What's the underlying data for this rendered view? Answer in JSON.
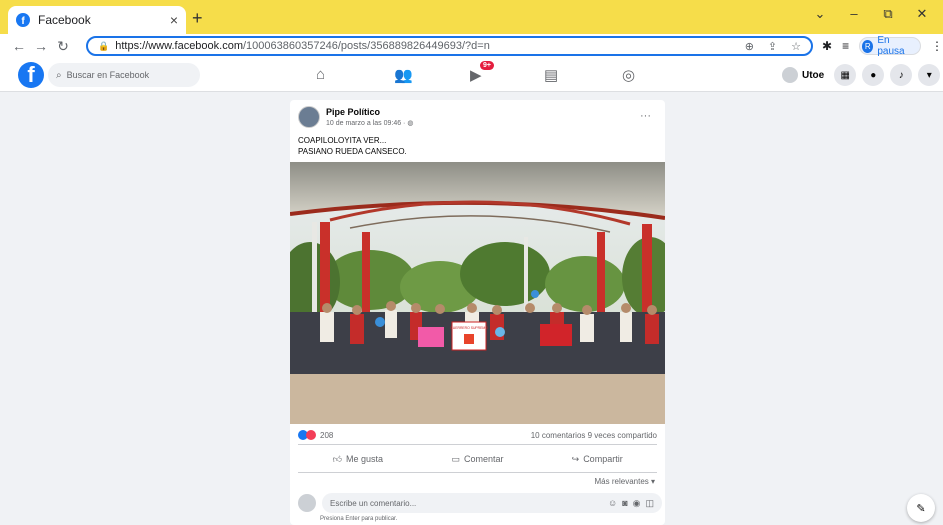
{
  "browser": {
    "tab_title": "Facebook",
    "tab_close": "×",
    "new_tab": "+",
    "url_host": "https://www.facebook.com",
    "url_path": "/100063860357246/posts/356889826449693/?d=n",
    "profile_initial": "R",
    "profile_status": "En pausa",
    "window_minimize": "–",
    "window_restore": "⧉",
    "window_close": "✕"
  },
  "facebook": {
    "logo_letter": "f",
    "search_placeholder": "Buscar en Facebook",
    "video_badge": "9+",
    "user_name": "Utoe"
  },
  "post": {
    "author": "Pipe Político",
    "date": "10 de marzo a las 09:46 · ",
    "line1": "COAPILOLOYITA VER...",
    "line2": "PASIANO RUEDA CANSECO.",
    "reactions_count": "208",
    "stats": "10 comentarios  9 veces compartido",
    "like_label": "Me gusta",
    "comment_label": "Comentar",
    "share_label": "Compartir",
    "sort_label": "Más relevantes ▾",
    "comment_placeholder": "Escribe un comentario...",
    "comment_hint": "Presiona Enter para publicar.",
    "banner_text": "GUERRERO SUPREMO"
  },
  "colors": {
    "chrome_bar": "#f6dd4a",
    "fb_blue": "#1877f2",
    "like_blue": "#1877f2",
    "love_red": "#f33e58"
  }
}
